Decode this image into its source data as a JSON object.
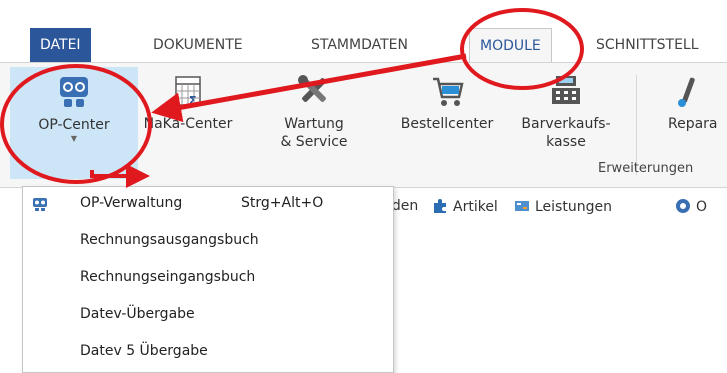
{
  "tabs": [
    {
      "label": "DATEI"
    },
    {
      "label": "DOKUMENTE"
    },
    {
      "label": "STAMMDATEN"
    },
    {
      "label": "MODULE"
    },
    {
      "label": "SCHNITTSTELL"
    }
  ],
  "ribbon": {
    "buttons": [
      {
        "label1": "OP-Center",
        "label2": ""
      },
      {
        "label1": "NaKa-Center",
        "label2": ""
      },
      {
        "label1": "Wartung",
        "label2": "& Service"
      },
      {
        "label1": "Bestellcenter",
        "label2": ""
      },
      {
        "label1": "Barverkaufs-",
        "label2": "kasse"
      },
      {
        "label1": "Repara",
        "label2": ""
      }
    ],
    "group_label": "Erweiterungen"
  },
  "quickbar": {
    "items": [
      {
        "label": "nden"
      },
      {
        "label": "Artikel"
      },
      {
        "label": "Leistungen"
      },
      {
        "label": "O"
      }
    ]
  },
  "menu": {
    "items": [
      {
        "label": "OP-Verwaltung",
        "shortcut": "Strg+Alt+O"
      },
      {
        "label": "Rechnungsausgangsbuch",
        "shortcut": ""
      },
      {
        "label": "Rechnungseingangsbuch",
        "shortcut": ""
      },
      {
        "label": "Datev-Übergabe",
        "shortcut": ""
      },
      {
        "label": "Datev 5 Übergabe",
        "shortcut": ""
      }
    ]
  },
  "colors": {
    "accent": "#2b579a",
    "selected": "#cde6f7",
    "annotation": "#e0191e"
  }
}
